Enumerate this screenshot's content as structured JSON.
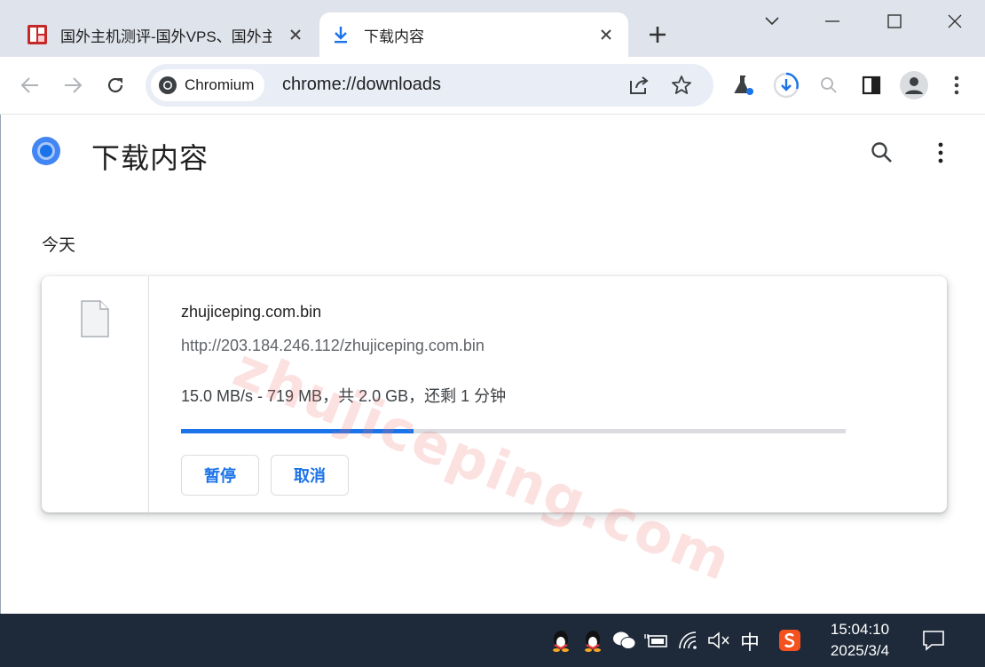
{
  "tabs": [
    {
      "title": "国外主机测评-国外VPS、国外主机",
      "close_icon": "close-icon"
    },
    {
      "title": "下载内容",
      "close_icon": "close-icon"
    }
  ],
  "toolbar": {
    "chip_label": "Chromium",
    "url": "chrome://downloads"
  },
  "page": {
    "title": "下载内容",
    "date_header": "今天",
    "watermark": "zhujiceping.com"
  },
  "download": {
    "file_name": "zhujiceping.com.bin",
    "url": "http://203.184.246.112/zhujiceping.com.bin",
    "status": "15.0 MB/s - 719 MB，共 2.0 GB，还剩 1 分钟",
    "progress_fraction": 0.35,
    "pause_label": "暂停",
    "cancel_label": "取消"
  },
  "taskbar": {
    "ime": "中",
    "time": "15:04:10",
    "date": "2025/3/4"
  },
  "colors": {
    "accent": "#1a73e8",
    "tabstrip": "#dfe3eb",
    "omnibox": "#e9edf6",
    "taskbar": "#1e2a3a"
  }
}
